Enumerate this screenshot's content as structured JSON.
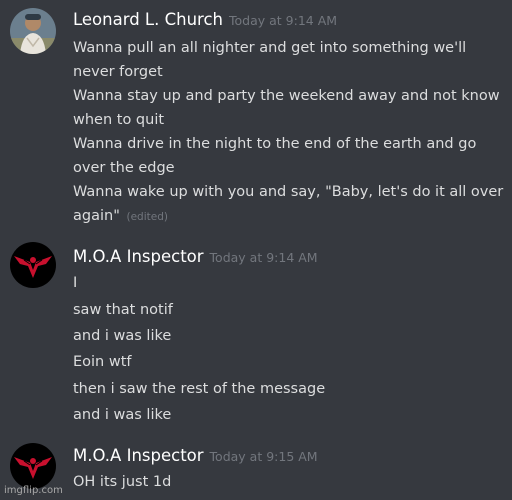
{
  "messages": [
    {
      "username": "Leonard L. Church",
      "timestamp": "Today at 9:14 AM",
      "avatar_icon": "person-photo-avatar",
      "lines": [
        "Wanna pull an all nighter and get into something we'll",
        "never forget",
        "Wanna stay up and party the weekend away and not know",
        "when to quit",
        "Wanna drive in the night to the end of the earth and go",
        "over the edge",
        "Wanna wake up with you and say, \"Baby, let's do it all over",
        "again\""
      ],
      "edited_label": "(edited)"
    },
    {
      "username": "M.O.A Inspector",
      "timestamp": "Today at 9:14 AM",
      "avatar_icon": "arstotzka-eagle-emblem-avatar",
      "lines": [
        "I",
        "saw that notif",
        "and i was like",
        "Eoin wtf",
        "then i saw the rest of the message",
        "and i was like"
      ]
    },
    {
      "username": "M.O.A Inspector",
      "timestamp": "Today at 9:15 AM",
      "avatar_icon": "arstotzka-eagle-emblem-avatar",
      "lines": [
        "OH its just 1d"
      ]
    }
  ],
  "watermark": "imgflip.com",
  "colors": {
    "background": "#36393f",
    "username": "#ffffff",
    "text": "#dcddde",
    "muted": "#72767d",
    "emblem_red": "#c8102e"
  }
}
